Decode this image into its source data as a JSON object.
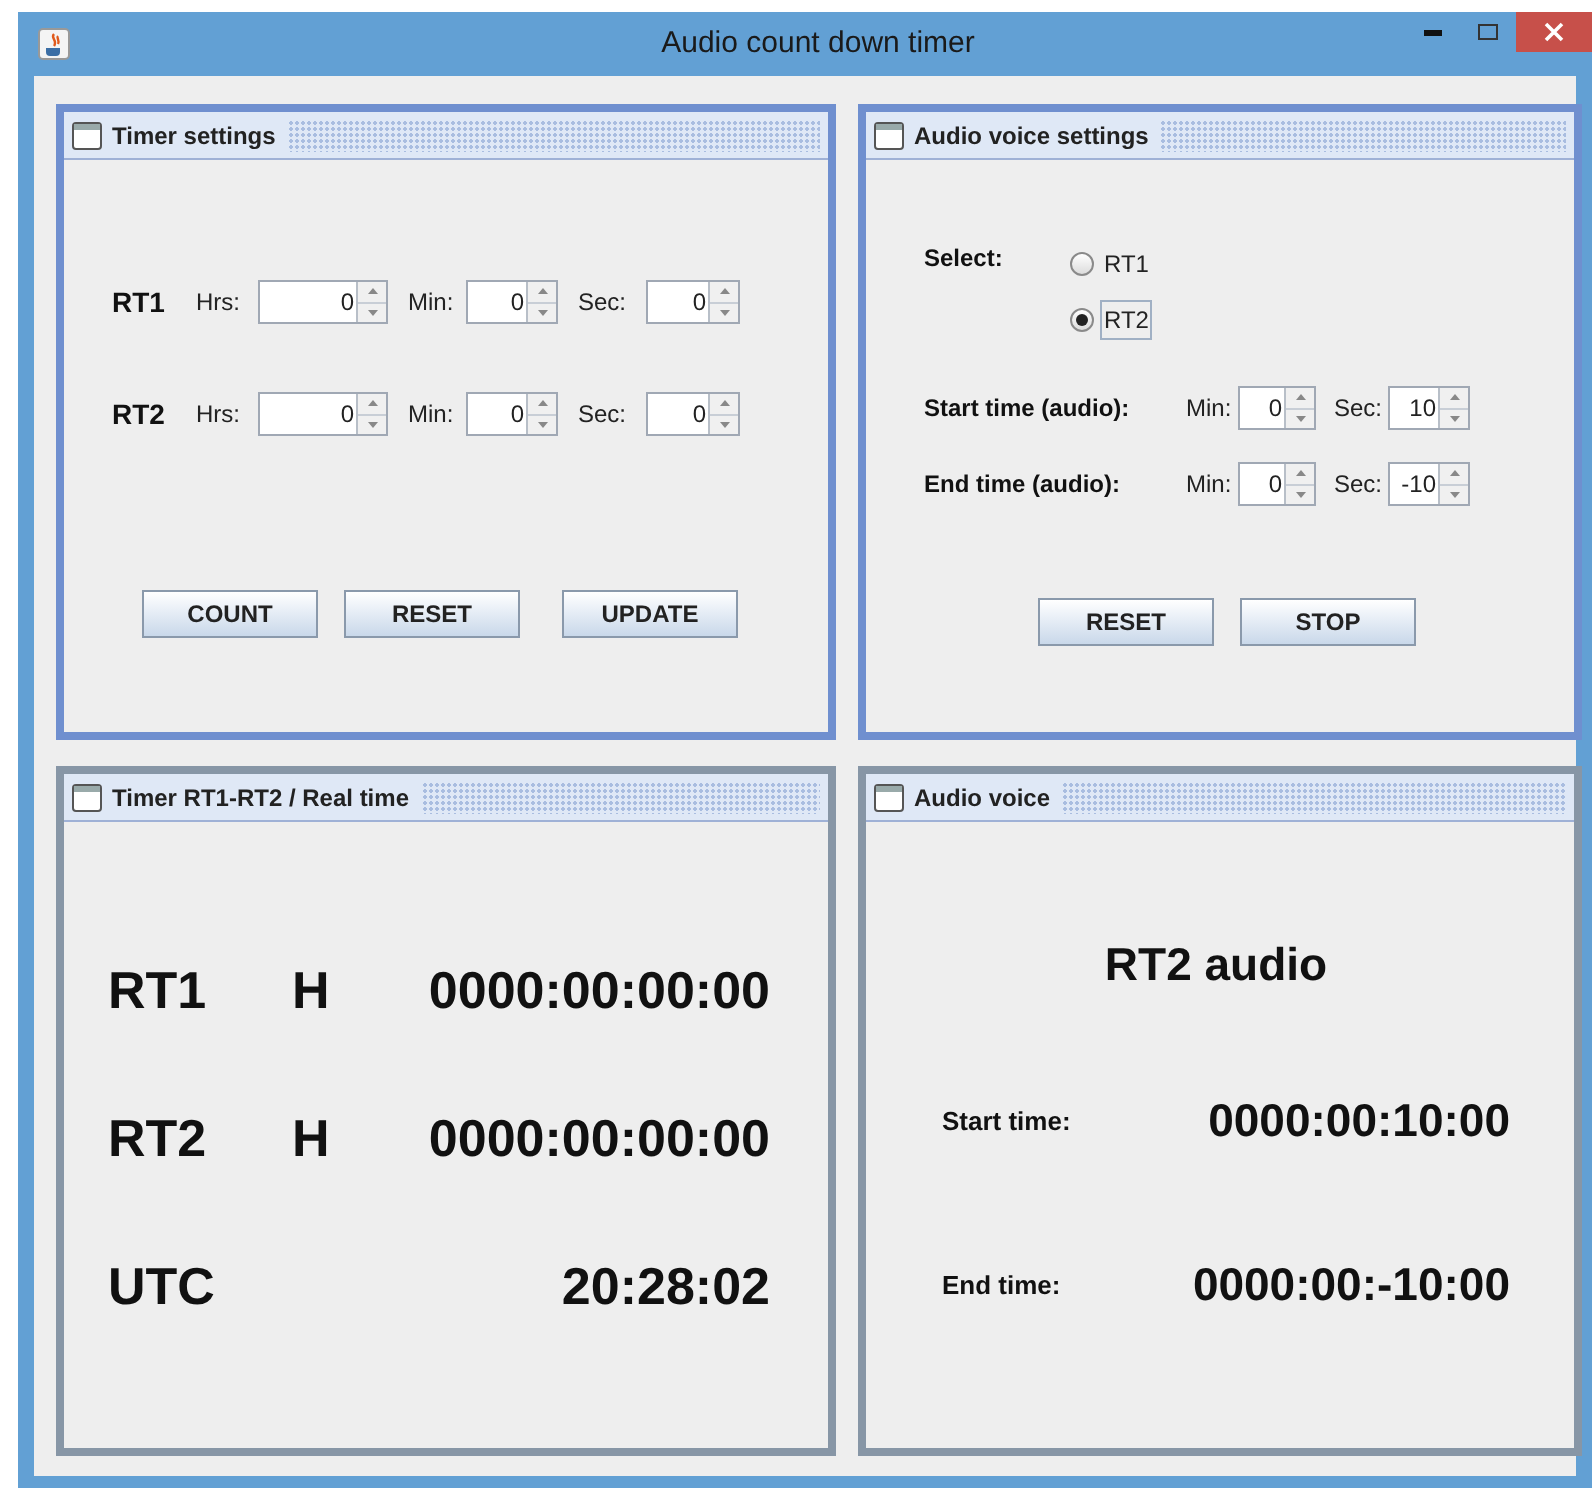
{
  "window": {
    "title": "Audio count down timer"
  },
  "timer_settings": {
    "title": "Timer settings",
    "rows": [
      {
        "label": "RT1",
        "fields": [
          {
            "label": "Hrs:",
            "value": "0"
          },
          {
            "label": "Min:",
            "value": "0"
          },
          {
            "label": "Sec:",
            "value": "0"
          }
        ]
      },
      {
        "label": "RT2",
        "fields": [
          {
            "label": "Hrs:",
            "value": "0"
          },
          {
            "label": "Min:",
            "value": "0"
          },
          {
            "label": "Sec:",
            "value": "0"
          }
        ]
      }
    ],
    "buttons": [
      "COUNT",
      "RESET",
      "UPDATE"
    ]
  },
  "audio_voice_settings": {
    "title": "Audio voice settings",
    "select_label": "Select:",
    "options": [
      {
        "label": "RT1",
        "selected": false
      },
      {
        "label": "RT2",
        "selected": true
      }
    ],
    "rows": [
      {
        "label": "Start time (audio):",
        "fields": [
          {
            "label": "Min:",
            "value": "0"
          },
          {
            "label": "Sec:",
            "value": "10"
          }
        ]
      },
      {
        "label": "End time (audio):",
        "fields": [
          {
            "label": "Min:",
            "value": "0"
          },
          {
            "label": "Sec:",
            "value": "-10"
          }
        ]
      }
    ],
    "buttons": [
      "RESET",
      "STOP"
    ]
  },
  "timer_display": {
    "title": "Timer RT1-RT2 / Real time",
    "rows": [
      {
        "label": "RT1",
        "unit": "H",
        "value": "0000:00:00:00"
      },
      {
        "label": "RT2",
        "unit": "H",
        "value": "0000:00:00:00"
      },
      {
        "label": "UTC",
        "value": "20:28:02"
      }
    ]
  },
  "audio_voice": {
    "title": "Audio voice",
    "heading": "RT2 audio",
    "rows": [
      {
        "label": "Start time:",
        "value": "0000:00:10:00"
      },
      {
        "label": "End time:",
        "value": "0000:00:-10:00"
      }
    ]
  }
}
